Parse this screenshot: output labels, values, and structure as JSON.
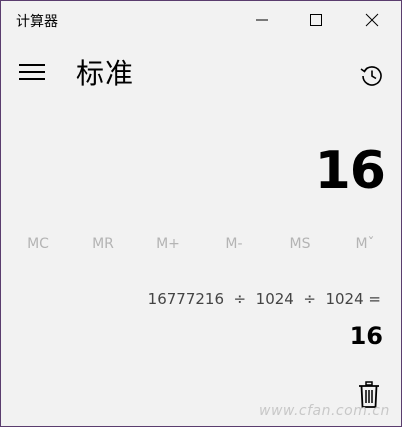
{
  "window": {
    "title": "计算器"
  },
  "header": {
    "mode_title": "标准"
  },
  "display": {
    "value": "16"
  },
  "memory": {
    "buttons": [
      "MC",
      "MR",
      "M+",
      "M-",
      "MS",
      "Mˇ"
    ]
  },
  "history": {
    "expression": "16777216  ÷  1024  ÷  1024 =",
    "result": "16"
  },
  "watermark": {
    "text": "www.cfan.com.cn"
  },
  "icons": {
    "minimize": "minimize-icon",
    "maximize": "maximize-icon",
    "close": "close-icon",
    "menu": "hamburger-menu-icon",
    "history": "history-clock-icon",
    "delete": "trash-icon"
  },
  "colors": {
    "background": "#f2f2f2",
    "disabled_text": "#b4b4b4",
    "border": "#5a3d6e"
  }
}
